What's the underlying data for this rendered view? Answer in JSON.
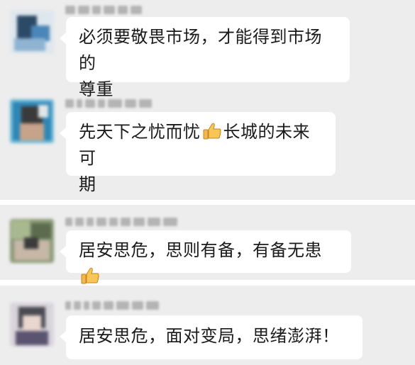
{
  "messages": [
    {
      "text": "必须要敬畏市场，才能得到市场的",
      "text2": "尊重",
      "icon": "thumbs-up-icon"
    },
    {
      "text": "先天下之忧而忧",
      "text_after_icon": "长城的未来可",
      "text2": "期",
      "icon": "thumbs-up-icon"
    },
    {
      "text": "居安思危，思则有备，有备无患",
      "icon": "thumbs-up-icon"
    },
    {
      "text": "居安思危，面对变局，思绪澎湃！"
    }
  ],
  "colors": {
    "panel_background": "#ededed",
    "bubble_background": "#ffffff",
    "separator": "#ffffff",
    "text": "#1a1a1a"
  }
}
